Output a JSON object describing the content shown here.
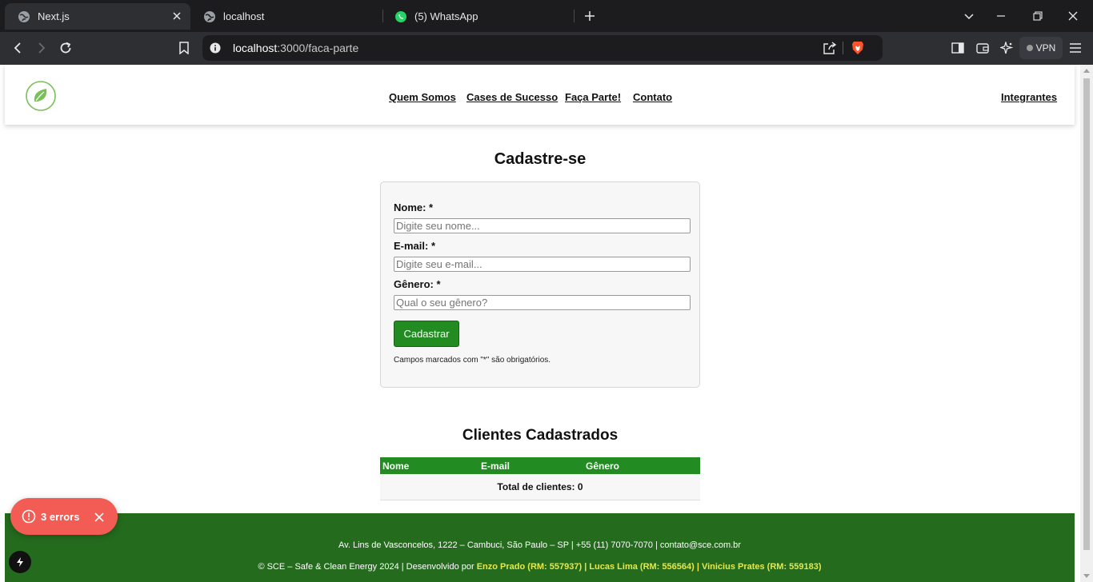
{
  "browser": {
    "tabs": [
      {
        "title": "Next.js",
        "icon": "globe-icon",
        "active": true
      },
      {
        "title": "localhost",
        "icon": "globe-icon",
        "active": false
      },
      {
        "title": "(5) WhatsApp",
        "icon": "whatsapp-icon",
        "active": false
      }
    ],
    "url_host": "localhost",
    "url_path": ":3000/faca-parte",
    "vpn_label": "VPN"
  },
  "header": {
    "nav": [
      "Quem Somos",
      "Cases de Sucesso",
      "Faça Parte!",
      "Contato"
    ],
    "right_link": "Integrantes"
  },
  "form": {
    "title": "Cadastre-se",
    "fields": [
      {
        "label": "Nome: *",
        "placeholder": "Digite seu nome..."
      },
      {
        "label": "E-mail: *",
        "placeholder": "Digite seu e-mail..."
      },
      {
        "label": "Gênero: *",
        "placeholder": "Qual o seu gênero?"
      }
    ],
    "submit_label": "Cadastrar",
    "note": "Campos marcados com \"*\" são obrigatórios."
  },
  "clients": {
    "title": "Clientes Cadastrados",
    "columns": [
      "Nome",
      "E-mail",
      "Gênero"
    ],
    "total": "Total de clientes: 0"
  },
  "footer": {
    "address": "Av. Lins de Vasconcelos, 1222 – Cambuci, São Paulo – SP | +55 (11) 7070-7070 | contato@sce.com.br",
    "copyright": "© SCE – Safe & Clean Energy 2024 | Desenvolvido por ",
    "developers": "Enzo Prado (RM: 557937) | Lucas Lima (RM: 556564) | Vinicius Prates (RM: 559183)"
  },
  "dev_overlay": {
    "errors_label": "3 errors"
  },
  "colors": {
    "brand_green": "#228b22",
    "footer_green": "#246b1e",
    "developer_highlight": "#e6e84a",
    "error_red": "#f25c54"
  }
}
